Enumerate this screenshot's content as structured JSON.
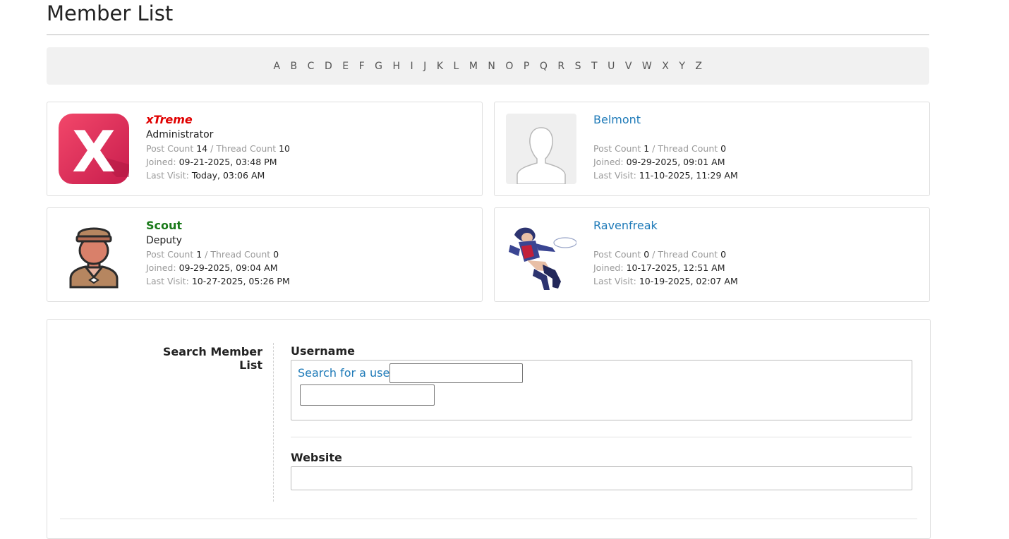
{
  "page": {
    "title": "Member List"
  },
  "alphabet": [
    "A",
    "B",
    "C",
    "D",
    "E",
    "F",
    "G",
    "H",
    "I",
    "J",
    "K",
    "L",
    "M",
    "N",
    "O",
    "P",
    "Q",
    "R",
    "S",
    "T",
    "U",
    "V",
    "W",
    "X",
    "Y",
    "Z"
  ],
  "members": [
    {
      "name": "xTreme",
      "role": "Administrator",
      "post_label": "Post Count",
      "post_count": "14",
      "thread_label": "Thread Count",
      "thread_count": "10",
      "joined_label": "Joined:",
      "joined": "09-21-2025, 03:48 PM",
      "visit_label": "Last Visit:",
      "last_visit": "Today, 03:06 AM",
      "avatar": "x-logo-avatar",
      "name_color": "#e00000"
    },
    {
      "name": "Belmont",
      "role": "",
      "post_label": "Post Count",
      "post_count": "1",
      "thread_label": "Thread Count",
      "thread_count": "0",
      "joined_label": "Joined:",
      "joined": "09-29-2025, 09:01 AM",
      "visit_label": "Last Visit:",
      "last_visit": "11-10-2025, 11:29 AM",
      "avatar": "default-person-avatar",
      "name_color": "#1e7ab8"
    },
    {
      "name": "Scout",
      "role": "Deputy",
      "post_label": "Post Count",
      "post_count": "1",
      "thread_label": "Thread Count",
      "thread_count": "0",
      "joined_label": "Joined:",
      "joined": "09-29-2025, 09:04 AM",
      "visit_label": "Last Visit:",
      "last_visit": "10-27-2025, 05:26 PM",
      "avatar": "scout-character-avatar",
      "name_color": "#1a7a1a"
    },
    {
      "name": "Ravenfreak",
      "role": "",
      "post_label": "Post Count",
      "post_count": "0",
      "thread_label": "Thread Count",
      "thread_count": "0",
      "joined_label": "Joined:",
      "joined": "10-17-2025, 12:51 AM",
      "visit_label": "Last Visit:",
      "last_visit": "10-19-2025, 02:07 AM",
      "avatar": "anime-character-avatar",
      "name_color": "#1e7ab8"
    }
  ],
  "search": {
    "heading": "Search Member List",
    "username_label": "Username",
    "search_link": "Search for a user",
    "username_value": "",
    "website_label": "Website",
    "website_value": ""
  }
}
